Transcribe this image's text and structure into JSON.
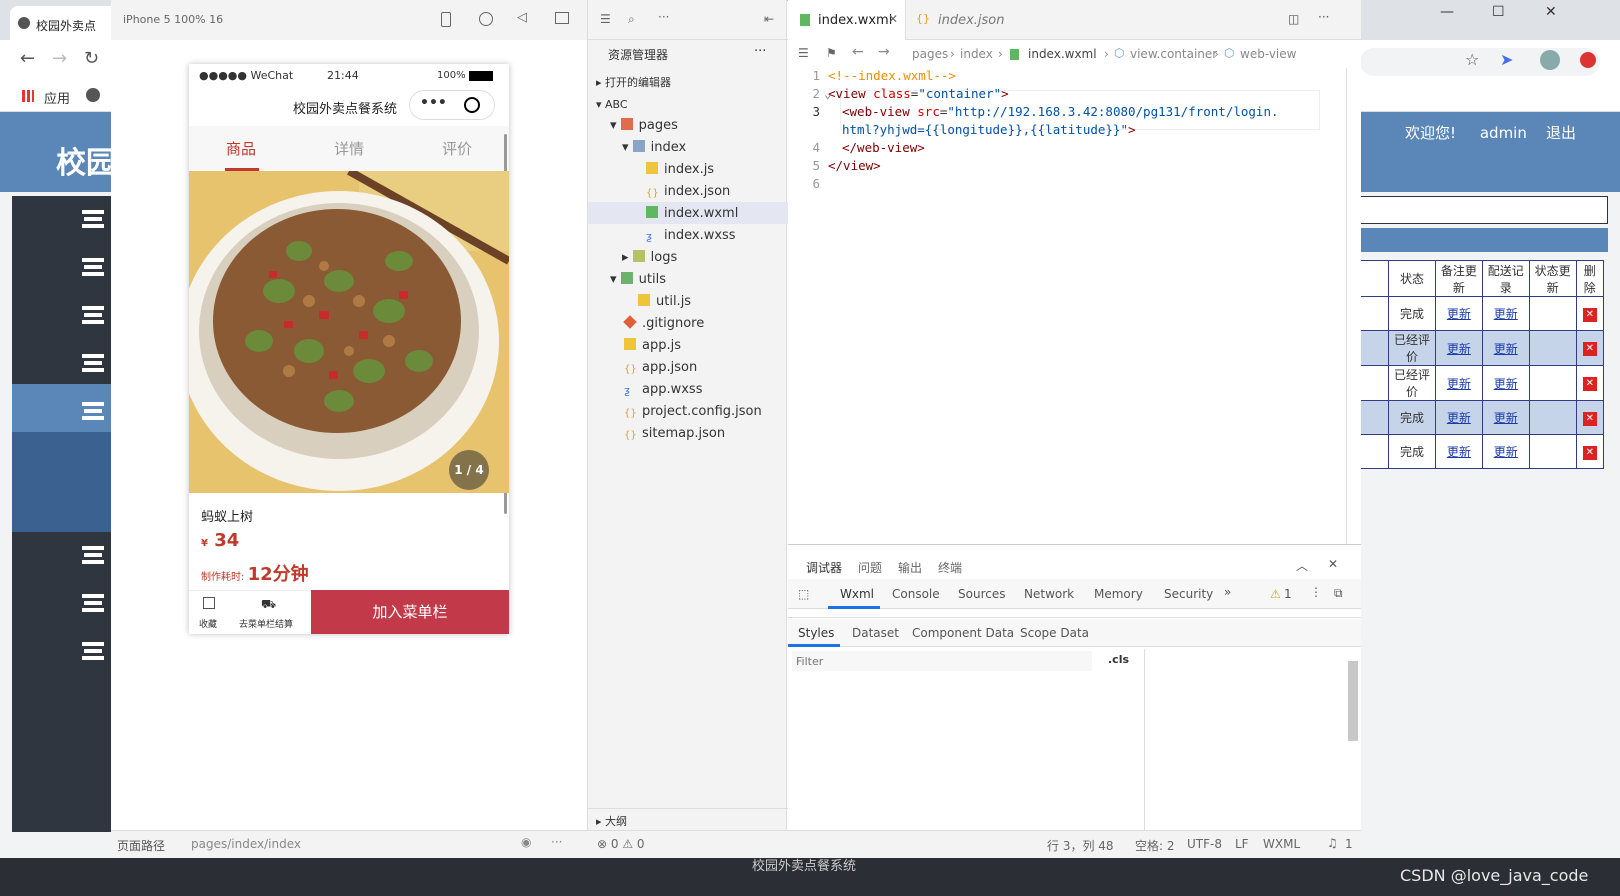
{
  "browser": {
    "tab_title": "校园外卖点",
    "bookmark_apps": "应用",
    "site_title": "校园",
    "welcome": "欢迎您!",
    "user": "admin",
    "logout": "退出",
    "table_headers": [
      "状态",
      "备注更新",
      "配送记录",
      "状态更新",
      "删除"
    ],
    "rows": [
      {
        "status": "完成",
        "remark": "更新",
        "delivery": "更新"
      },
      {
        "status": "已经评价",
        "remark": "更新",
        "delivery": "更新"
      },
      {
        "status": "已经评价",
        "remark": "更新",
        "delivery": "更新"
      },
      {
        "status": "完成",
        "remark": "更新",
        "delivery": "更新"
      },
      {
        "status": "完成",
        "remark": "更新",
        "delivery": "更新"
      }
    ],
    "footer": "校园外卖点餐系统",
    "watermark": "CSDN @love_java_code"
  },
  "simulator": {
    "device": "iPhone 5 100% 16",
    "carrier": "●●●●● WeChat",
    "time": "21:44",
    "battery": "100%",
    "nav_title": "校园外卖点餐系统",
    "tabs": [
      "商品",
      "详情",
      "评价"
    ],
    "image_counter": "1 / 4",
    "dish_name": "蚂蚁上树",
    "currency": "¥",
    "price": "34",
    "cook_label": "制作耗时:",
    "cook_time": "12分钟",
    "fav": "收藏",
    "cart": "去菜单栏结算",
    "add_button": "加入菜单栏",
    "page_path_label": "页面路径",
    "page_path": "pages/index/index"
  },
  "explorer": {
    "title": "资源管理器",
    "open_editors": "打开的编辑器",
    "project": "ABC",
    "items": [
      "pages",
      "index",
      "index.js",
      "index.json",
      "index.wxml",
      "index.wxss",
      "logs",
      "utils",
      "util.js",
      ".gitignore",
      "app.js",
      "app.json",
      "app.wxss",
      "project.config.json",
      "sitemap.json"
    ],
    "outline": "大纲"
  },
  "editor": {
    "tabs": [
      "index.wxml",
      "index.json"
    ],
    "breadcrumb": [
      "pages",
      "index",
      "index.wxml",
      "view.container",
      "web-view"
    ],
    "lines": [
      "1",
      "2",
      "3",
      "",
      "4",
      "5",
      "6"
    ],
    "code": {
      "l1": "<!--index.wxml-->",
      "l2a": "<view ",
      "l2b": "class",
      "l2c": "=",
      "l2d": "\"container\"",
      "l2e": ">",
      "l3a": "<web-view ",
      "l3b": "src",
      "l3c": "=",
      "l3d": "\"http://192.168.3.42:8080/pg131/front/login.",
      "l3e": "html?yhjwd={{longitude}},{{latitude}}\"",
      "l3f": ">",
      "l4": "</web-view>",
      "l5": "</view>"
    }
  },
  "devtools": {
    "top_tabs": [
      "调试器",
      "问题",
      "输出",
      "终端"
    ],
    "panel_tabs": [
      "Wxml",
      "Console",
      "Sources",
      "Network",
      "Memory",
      "Security"
    ],
    "warn_count": "1",
    "sub_tabs": [
      "Styles",
      "Dataset",
      "Component Data",
      "Scope Data"
    ],
    "filter_placeholder": "Filter",
    "cls": ".cls"
  },
  "statusbar": {
    "errors": "0",
    "warnings": "0",
    "position": "行 3，列 48",
    "spaces": "空格: 2",
    "encoding": "UTF-8",
    "eol": "LF",
    "lang": "WXML",
    "notifications": "1"
  }
}
